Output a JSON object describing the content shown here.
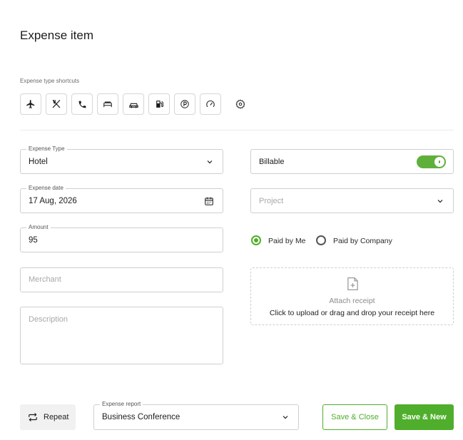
{
  "title": "Expense item",
  "shortcuts": {
    "label": "Expense type shortcuts",
    "items": [
      "plane-icon",
      "restaurant-icon",
      "phone-icon",
      "bed-icon",
      "car-icon",
      "fuel-icon",
      "parking-icon",
      "mileage-icon"
    ],
    "settings_icon": "gear-icon"
  },
  "expense_type": {
    "label": "Expense Type",
    "value": "Hotel"
  },
  "expense_date": {
    "label": "Expense date",
    "value": "17 Aug, 2026"
  },
  "amount": {
    "label": "Amount",
    "value": "95"
  },
  "merchant": {
    "placeholder": "Merchant"
  },
  "description": {
    "placeholder": "Description"
  },
  "billable": {
    "label": "Billable",
    "on": true
  },
  "project": {
    "placeholder": "Project"
  },
  "paid_by": {
    "options": [
      "Paid by Me",
      "Paid by Company"
    ],
    "selected": "Paid by Me"
  },
  "receipt": {
    "title": "Attach receipt",
    "hint": "Click to upload or drag and drop your receipt here"
  },
  "footer": {
    "repeat_label": "Repeat",
    "report_label": "Expense report",
    "report_value": "Business Conference",
    "save_close_label": "Save & Close",
    "save_new_label": "Save & New"
  },
  "colors": {
    "accent": "#4fae2b"
  }
}
